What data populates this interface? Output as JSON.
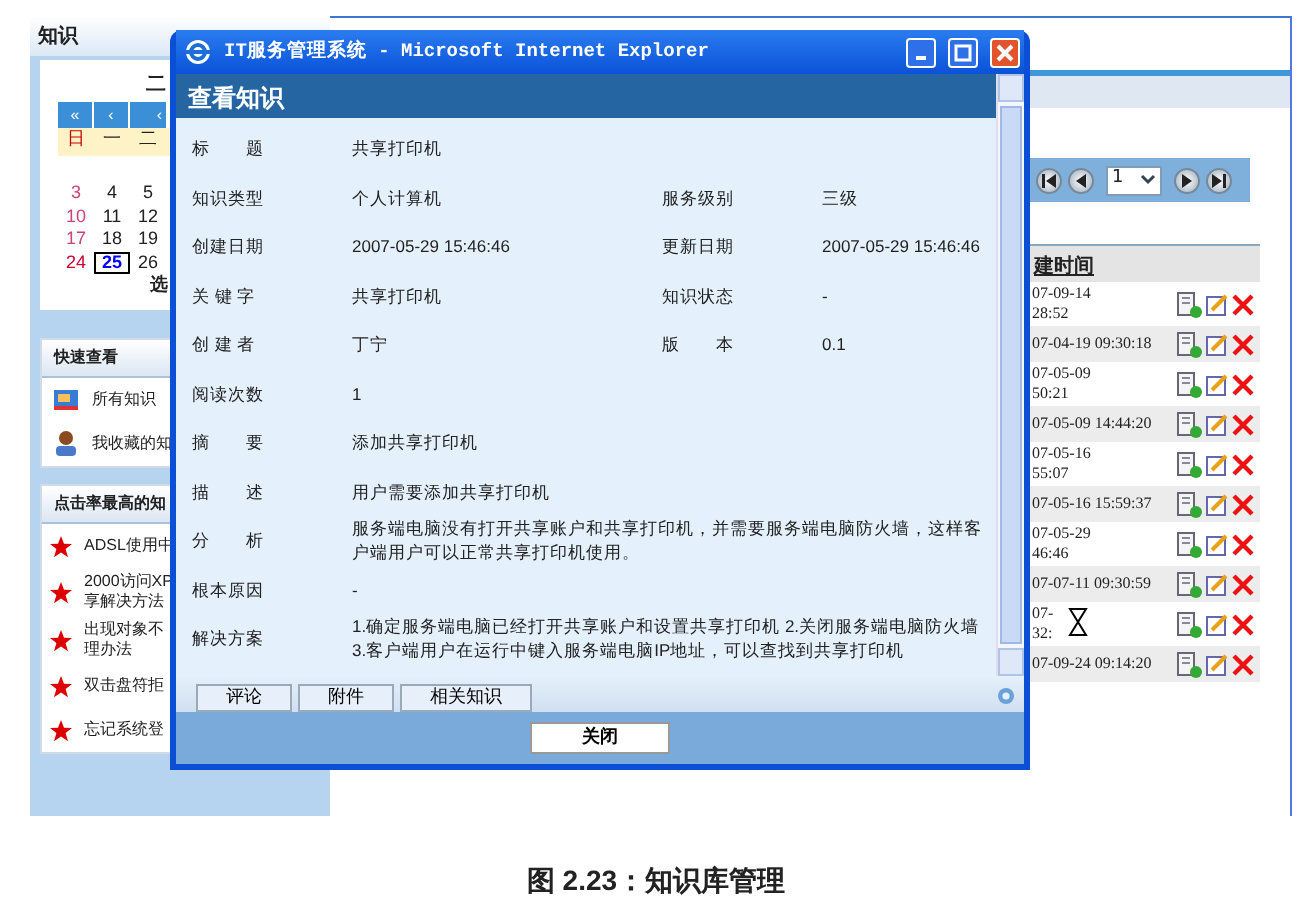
{
  "app": {
    "panel_title": "知识",
    "calendar": {
      "month": "二",
      "nav": [
        "«",
        "‹",
        "‹"
      ],
      "weekdays": [
        "日",
        "一",
        "二"
      ],
      "weeks": [
        [
          {
            "text": "3",
            "selected": false
          },
          {
            "text": "4",
            "selected": false
          },
          {
            "text": "5",
            "selected": false
          }
        ],
        [
          {
            "text": "10",
            "selected": false
          },
          {
            "text": "11",
            "selected": false
          },
          {
            "text": "12",
            "selected": false
          }
        ],
        [
          {
            "text": "17",
            "selected": false
          },
          {
            "text": "18",
            "selected": false
          },
          {
            "text": "19",
            "selected": false
          }
        ],
        [
          {
            "text": "24",
            "selected": false
          },
          {
            "text": "25",
            "selected": true
          },
          {
            "text": "26",
            "selected": false
          }
        ]
      ],
      "footer": "选"
    },
    "quick_view": {
      "title": "快速查看",
      "items": [
        {
          "label": "所有知识",
          "kind": "all"
        },
        {
          "label": "我收藏的知",
          "kind": "favorite"
        }
      ]
    },
    "top_clicked": {
      "title": "点击率最高的知",
      "items": [
        {
          "lines": [
            "ADSL使用中"
          ]
        },
        {
          "lines": [
            "2000访问XP",
            "享解决方法"
          ]
        },
        {
          "lines": [
            "出现对象不",
            "理办法"
          ]
        },
        {
          "lines": [
            "双击盘符拒"
          ]
        },
        {
          "lines": [
            "忘记系统登"
          ]
        }
      ]
    },
    "pager": {
      "page": "1"
    },
    "table": {
      "column": "建时间",
      "rows": [
        {
          "time": [
            "07-09-14",
            "28:52"
          ],
          "cursor": false
        },
        {
          "time": [
            "07-04-19 09:30:18"
          ],
          "cursor": false
        },
        {
          "time": [
            "07-05-09",
            "50:21"
          ],
          "cursor": false
        },
        {
          "time": [
            "07-05-09 14:44:20"
          ],
          "cursor": false
        },
        {
          "time": [
            "07-05-16",
            "55:07"
          ],
          "cursor": false
        },
        {
          "time": [
            "07-05-16 15:59:37"
          ],
          "cursor": false
        },
        {
          "time": [
            "07-05-29",
            "46:46"
          ],
          "cursor": false
        },
        {
          "time": [
            "07-07-11 09:30:59"
          ],
          "cursor": false
        },
        {
          "time": [
            "07-",
            "32:"
          ],
          "cursor": true
        },
        {
          "time": [
            "07-09-24 09:14:20"
          ],
          "cursor": false
        }
      ]
    }
  },
  "dialog": {
    "title": "IT服务管理系统 - Microsoft Internet Explorer",
    "heading": "查看知识",
    "fields": [
      {
        "label": "标　　题",
        "value": "共享打印机"
      },
      {
        "label": "知识类型",
        "value": "个人计算机",
        "label2": "服务级别",
        "value2": "三级"
      },
      {
        "label": "创建日期",
        "value": "2007-05-29 15:46:46",
        "label2": "更新日期",
        "value2": "2007-05-29 15:46:46"
      },
      {
        "label": "关 键 字",
        "value": "共享打印机",
        "label2": "知识状态",
        "value2": "-"
      },
      {
        "label": "创 建 者",
        "value": "丁宁",
        "label2": "版　　本",
        "value2": "0.1"
      },
      {
        "label": "阅读次数",
        "value": "1"
      },
      {
        "label": "摘　　要",
        "value": "添加共享打印机"
      },
      {
        "label": "描　　述",
        "value": "用户需要添加共享打印机"
      },
      {
        "label": "分　　析",
        "value": "服务端电脑没有打开共享账户和共享打印机，并需要服务端电脑防火墙，这样客户端用户可以正常共享打印机使用。"
      },
      {
        "label": "根本原因",
        "value": "-"
      },
      {
        "label": "解决方案",
        "value": "1.确定服务端电脑已经打开共享账户和设置共享打印机 2.关闭服务端电脑防火墙 3.客户端用户在运行中键入服务端电脑IP地址，可以查找到共享打印机"
      }
    ],
    "tabs": [
      "评论",
      "附件",
      "相关知识"
    ],
    "close_button": "关闭"
  },
  "caption": "图 2.23：知识库管理"
}
